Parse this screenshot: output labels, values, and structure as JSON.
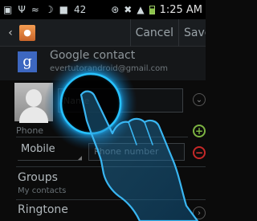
{
  "status_bar": {
    "battery_percent": "42",
    "time": "1:25 AM",
    "icons": [
      "media-icon",
      "usb-icon",
      "wifi-icon",
      "moon-icon",
      "screenshot-icon",
      "bluetooth-icon",
      "mute-icon",
      "signal-icon",
      "battery-icon"
    ]
  },
  "action_bar": {
    "cancel_label": "Cancel",
    "save_label": "Save"
  },
  "account": {
    "logo": "g",
    "title": "Google contact",
    "email": "evertutorandroid@gmail.com"
  },
  "name_field": {
    "placeholder": "Name"
  },
  "phone": {
    "section_label": "Phone",
    "type": "Mobile",
    "placeholder": "Phone number"
  },
  "groups": {
    "title": "Groups",
    "value": "My contacts"
  },
  "ringtone": {
    "title": "Ringtone"
  },
  "colors": {
    "accent_glow": "#1fb8ff",
    "add_green": "#7cb342",
    "remove_red": "#e53935"
  }
}
